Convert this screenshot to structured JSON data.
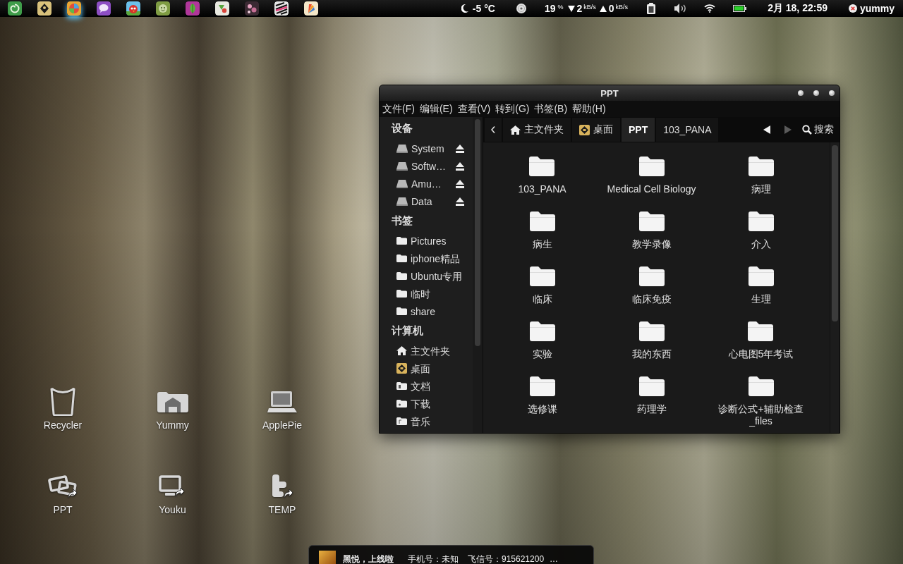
{
  "top_panel": {
    "launchers": [
      {
        "active": false
      },
      {
        "active": false
      },
      {
        "active": true
      },
      {
        "active": false
      },
      {
        "active": false
      },
      {
        "active": false
      },
      {
        "active": false
      },
      {
        "active": false
      },
      {
        "active": false
      },
      {
        "active": false
      },
      {
        "active": false
      }
    ],
    "weather": {
      "temperature": "-5 °C"
    },
    "cpu": {
      "value": "19",
      "unit": "%"
    },
    "network": {
      "down": {
        "value": "2",
        "unit": "kB/s"
      },
      "up": {
        "value": "0",
        "unit": "kB/s"
      }
    },
    "clock": "2月 18, 22:59",
    "user": {
      "name": "yummy"
    }
  },
  "file_manager": {
    "title": "PPT",
    "menu": [
      "文件(F)",
      "编辑(E)",
      "查看(V)",
      "转到(G)",
      "书签(B)",
      "帮助(H)"
    ],
    "sidebar": [
      {
        "heading": "设备",
        "items": [
          {
            "label": "System",
            "kind": "drive"
          },
          {
            "label": "Softw…",
            "kind": "drive"
          },
          {
            "label": "Amu…",
            "kind": "drive"
          },
          {
            "label": "Data",
            "kind": "drive"
          }
        ]
      },
      {
        "heading": "书签",
        "items": [
          {
            "label": "Pictures",
            "kind": "folder"
          },
          {
            "label": "iphone精品",
            "kind": "folder"
          },
          {
            "label": "Ubuntu专用",
            "kind": "folder"
          },
          {
            "label": "临时",
            "kind": "folder"
          },
          {
            "label": "share",
            "kind": "folder"
          }
        ]
      },
      {
        "heading": "计算机",
        "items": [
          {
            "label": "主文件夹",
            "kind": "home"
          },
          {
            "label": "桌面",
            "kind": "desktop"
          },
          {
            "label": "文档",
            "kind": "documents"
          },
          {
            "label": "下载",
            "kind": "downloads"
          },
          {
            "label": "音乐",
            "kind": "music"
          }
        ]
      }
    ],
    "path_bar": {
      "crumbs": [
        {
          "label": "主文件夹",
          "kind": "home",
          "selected": false
        },
        {
          "label": "桌面",
          "kind": "desktop",
          "selected": false
        },
        {
          "label": "PPT",
          "kind": "folder",
          "selected": true
        },
        {
          "label": "103_PANA",
          "kind": "folder",
          "selected": false
        }
      ],
      "back": {
        "disabled": false
      },
      "forward": {
        "disabled": true
      },
      "search": "搜索"
    },
    "folders": [
      {
        "name": "103_PANA"
      },
      {
        "name": "Medical Cell Biology"
      },
      {
        "name": "病理"
      },
      {
        "name": "病生"
      },
      {
        "name": "教学录像"
      },
      {
        "name": "介入"
      },
      {
        "name": "临床"
      },
      {
        "name": "临床免疫"
      },
      {
        "name": "生理"
      },
      {
        "name": "实验"
      },
      {
        "name": "我的东西"
      },
      {
        "name": "心电图5年考试"
      },
      {
        "name": "选修课"
      },
      {
        "name": "药理学"
      },
      {
        "name": "诊断公式+辅助检查_files"
      }
    ]
  },
  "desktop_icons": [
    {
      "label": "Recycler",
      "kind": "trash"
    },
    {
      "label": "Yummy",
      "kind": "home"
    },
    {
      "label": "ApplePie",
      "kind": "laptop"
    },
    {
      "label": "PPT",
      "kind": "pictures-link"
    },
    {
      "label": "Youku",
      "kind": "monitor-link"
    },
    {
      "label": "TEMP",
      "kind": "t-link"
    }
  ],
  "notification": {
    "title": "黑悦，上线啦",
    "phone": "手机号：未知",
    "fetion": "飞信号：915621200",
    "more": "…"
  }
}
